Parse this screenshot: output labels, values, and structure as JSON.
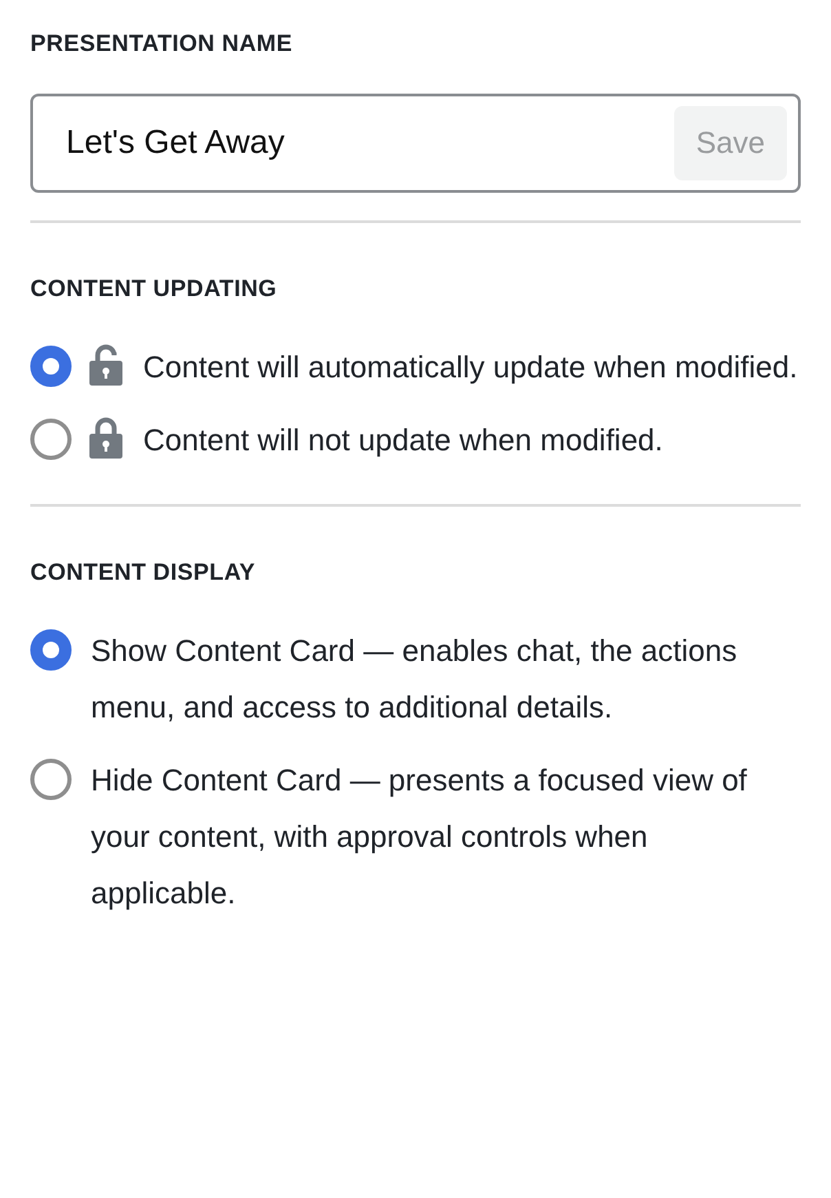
{
  "presentation_name": {
    "heading": "PRESENTATION NAME",
    "value": "Let's Get Away",
    "save_button": {
      "label": "Save",
      "disabled": true
    }
  },
  "content_updating": {
    "heading": "CONTENT UPDATING",
    "options": [
      {
        "label": "Content will automatically update when modified.",
        "selected": true,
        "locked": false
      },
      {
        "label": "Content will not update when modified.",
        "selected": false,
        "locked": true
      }
    ]
  },
  "content_display": {
    "heading": "CONTENT DISPLAY",
    "options": [
      {
        "label": "Show Content Card — enables chat, the actions menu, and access to additional details.",
        "selected": true
      },
      {
        "label": "Hide Content Card — presents a focused view of your content, with approval controls when applicable.",
        "selected": false
      }
    ]
  }
}
